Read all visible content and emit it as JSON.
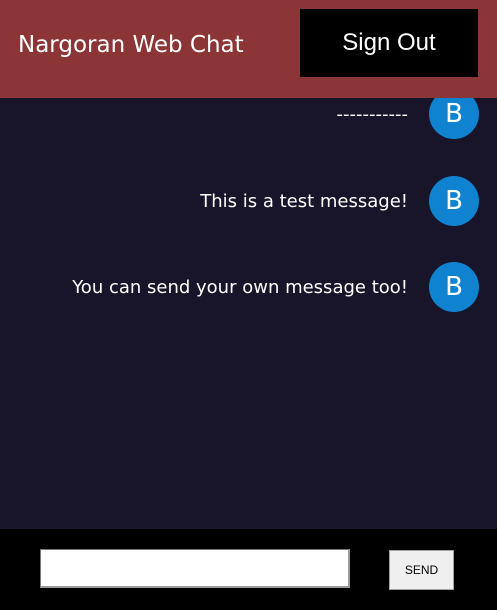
{
  "header": {
    "title": "Nargoran Web Chat",
    "sign_out_label": "Sign Out"
  },
  "messages": [
    {
      "text": "-----------",
      "avatar_letter": "B"
    },
    {
      "text": "This is a test message!",
      "avatar_letter": "B"
    },
    {
      "text": "You can send your own message too!",
      "avatar_letter": "B"
    }
  ],
  "composer": {
    "input_value": "",
    "send_label": "SEND"
  },
  "colors": {
    "header_bg": "#8b3536",
    "chat_bg": "#18152a",
    "avatar_bg": "#0f82d0",
    "footer_bg": "#000000"
  }
}
